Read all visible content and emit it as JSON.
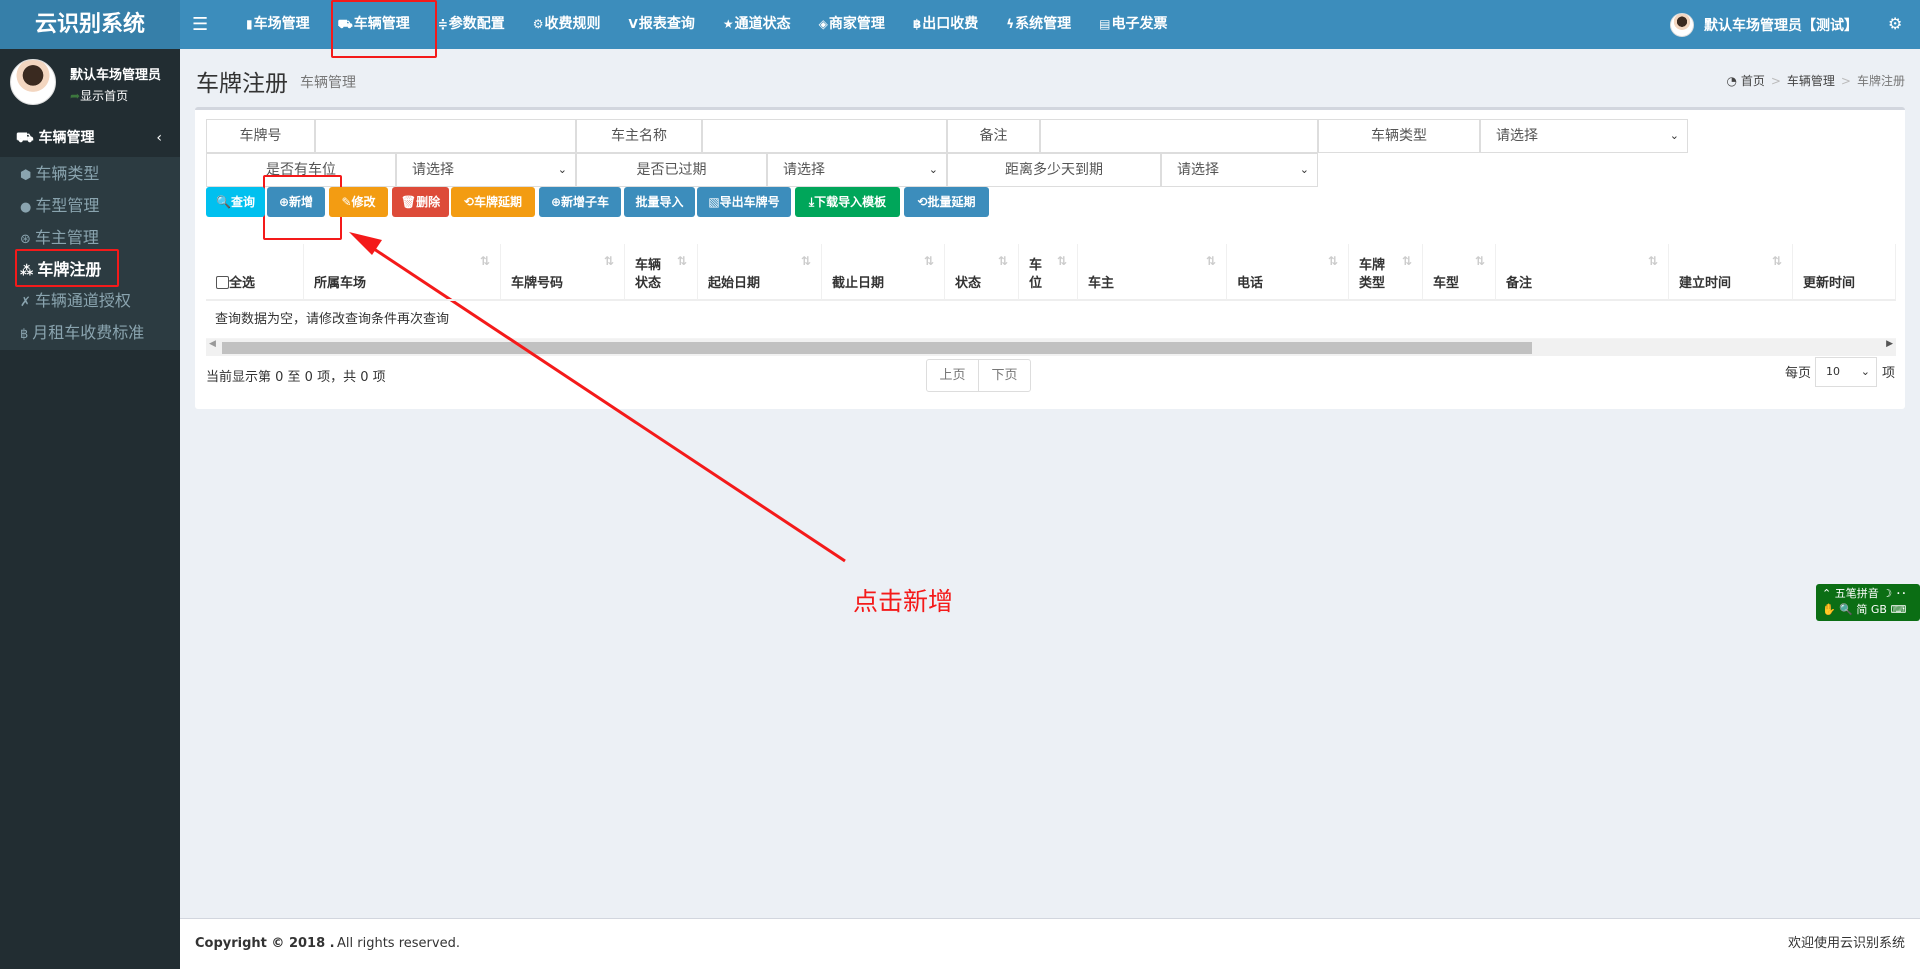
{
  "app": {
    "title": "云识别系统"
  },
  "nav": {
    "items": [
      {
        "label": "车场管理",
        "icon": "▮"
      },
      {
        "label": "车辆管理",
        "icon": "⛟"
      },
      {
        "label": "参数配置",
        "icon": "≑"
      },
      {
        "label": "收费规则",
        "icon": "⚙"
      },
      {
        "label": "报表查询",
        "icon": "V"
      },
      {
        "label": "通道状态",
        "icon": "★"
      },
      {
        "label": "商家管理",
        "icon": "◈"
      },
      {
        "label": "出口收费",
        "icon": "฿"
      },
      {
        "label": "系统管理",
        "icon": "ϟ"
      },
      {
        "label": "电子发票",
        "icon": "▤"
      }
    ],
    "active": "车辆管理",
    "user": "默认车场管理员【测试】"
  },
  "sidebar": {
    "user_name": "默认车场管理员",
    "user_link": "显示首页",
    "menu_header": "车辆管理",
    "items": [
      {
        "label": "车辆类型",
        "icon": "⬢"
      },
      {
        "label": "车型管理",
        "icon": "●"
      },
      {
        "label": "车主管理",
        "icon": "⊛"
      },
      {
        "label": "车牌注册",
        "icon": "⁂"
      },
      {
        "label": "车辆通道授权",
        "icon": "✗"
      },
      {
        "label": "月租车收费标准",
        "icon": "฿"
      }
    ],
    "active": "车牌注册"
  },
  "header": {
    "title": "车牌注册",
    "subtitle": "车辆管理",
    "breadcrumb": [
      "首页",
      "车辆管理",
      "车牌注册"
    ]
  },
  "filters": {
    "plate": "车牌号",
    "owner": "车主名称",
    "remark": "备注",
    "vehicle_type": "车辆类型",
    "has_space": "是否有车位",
    "expired": "是否已过期",
    "days_left": "距离多少天到期",
    "placeholder": "请选择"
  },
  "buttons": [
    {
      "label": "查询",
      "icon": "🔍",
      "color": "#00c0ef"
    },
    {
      "label": "新增",
      "icon": "⊕",
      "color": "#3c8dbc"
    },
    {
      "label": "修改",
      "icon": "✎",
      "color": "#f39c12"
    },
    {
      "label": "删除",
      "icon": "🗑",
      "color": "#dd4b39"
    },
    {
      "label": "车牌延期",
      "icon": "⟲",
      "color": "#f39c12"
    },
    {
      "label": "新增子车",
      "icon": "⊕",
      "color": "#3c8dbc"
    },
    {
      "label": "批量导入",
      "icon": "",
      "color": "#3c8dbc"
    },
    {
      "label": "导出车牌号",
      "icon": "▧",
      "color": "#3c8dbc"
    },
    {
      "label": "下载导入模板",
      "icon": "⤓",
      "color": "#00a65a"
    },
    {
      "label": "批量延期",
      "icon": "⟲",
      "color": "#3c8dbc"
    }
  ],
  "table": {
    "select_all": "全选",
    "columns": [
      "所属车场",
      "车牌号码",
      "车辆\n状态",
      "起始日期",
      "截止日期",
      "状态",
      "车\n位",
      "车主",
      "电话",
      "车牌\n类型",
      "车型",
      "备注",
      "建立时间",
      "更新时间"
    ],
    "empty": "查询数据为空，请修改查询条件再次查询",
    "info": "当前显示第 0 至 0 项，共 0 项",
    "prev": "上页",
    "next": "下页",
    "per_page_label": "每页",
    "per_page": "10",
    "per_page_unit": "项"
  },
  "annotation": "点击新增",
  "footer": {
    "copyright": "Copyright © 2018 .",
    "rights": "All rights reserved.",
    "welcome": "欢迎使用云识别系统"
  },
  "ime": {
    "name": "五笔拼音",
    "mode": "简",
    "charset": "GB"
  }
}
